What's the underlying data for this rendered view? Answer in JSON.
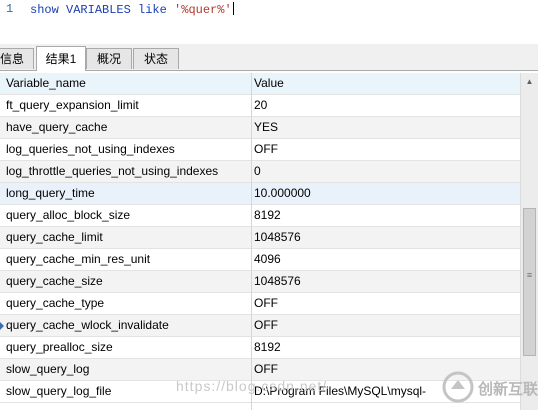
{
  "editor": {
    "line_number": "1",
    "sql_keyword1": "show",
    "sql_keyword2": "VARIABLES",
    "sql_keyword3": "like",
    "sql_string": "'%quer%'"
  },
  "tabs": [
    {
      "label": "信息"
    },
    {
      "label": "结果1"
    },
    {
      "label": "概况"
    },
    {
      "label": "状态"
    }
  ],
  "grid": {
    "columns": [
      "Variable_name",
      "Value"
    ],
    "rows": [
      [
        "ft_query_expansion_limit",
        "20"
      ],
      [
        "have_query_cache",
        "YES"
      ],
      [
        "log_queries_not_using_indexes",
        "OFF"
      ],
      [
        "log_throttle_queries_not_using_indexes",
        "0"
      ],
      [
        "long_query_time",
        "10.000000"
      ],
      [
        "query_alloc_block_size",
        "8192"
      ],
      [
        "query_cache_limit",
        "1048576"
      ],
      [
        "query_cache_min_res_unit",
        "4096"
      ],
      [
        "query_cache_size",
        "1048576"
      ],
      [
        "query_cache_type",
        "OFF"
      ],
      [
        "query_cache_wlock_invalidate",
        "OFF"
      ],
      [
        "query_prealloc_size",
        "8192"
      ],
      [
        "slow_query_log",
        "OFF"
      ],
      [
        "slow_query_log_file",
        "D:\\Program Files\\MySQL\\mysql-"
      ]
    ]
  },
  "watermark": {
    "text": "https://blog.csdn.net/"
  },
  "logo": {
    "text": "创新互联"
  }
}
